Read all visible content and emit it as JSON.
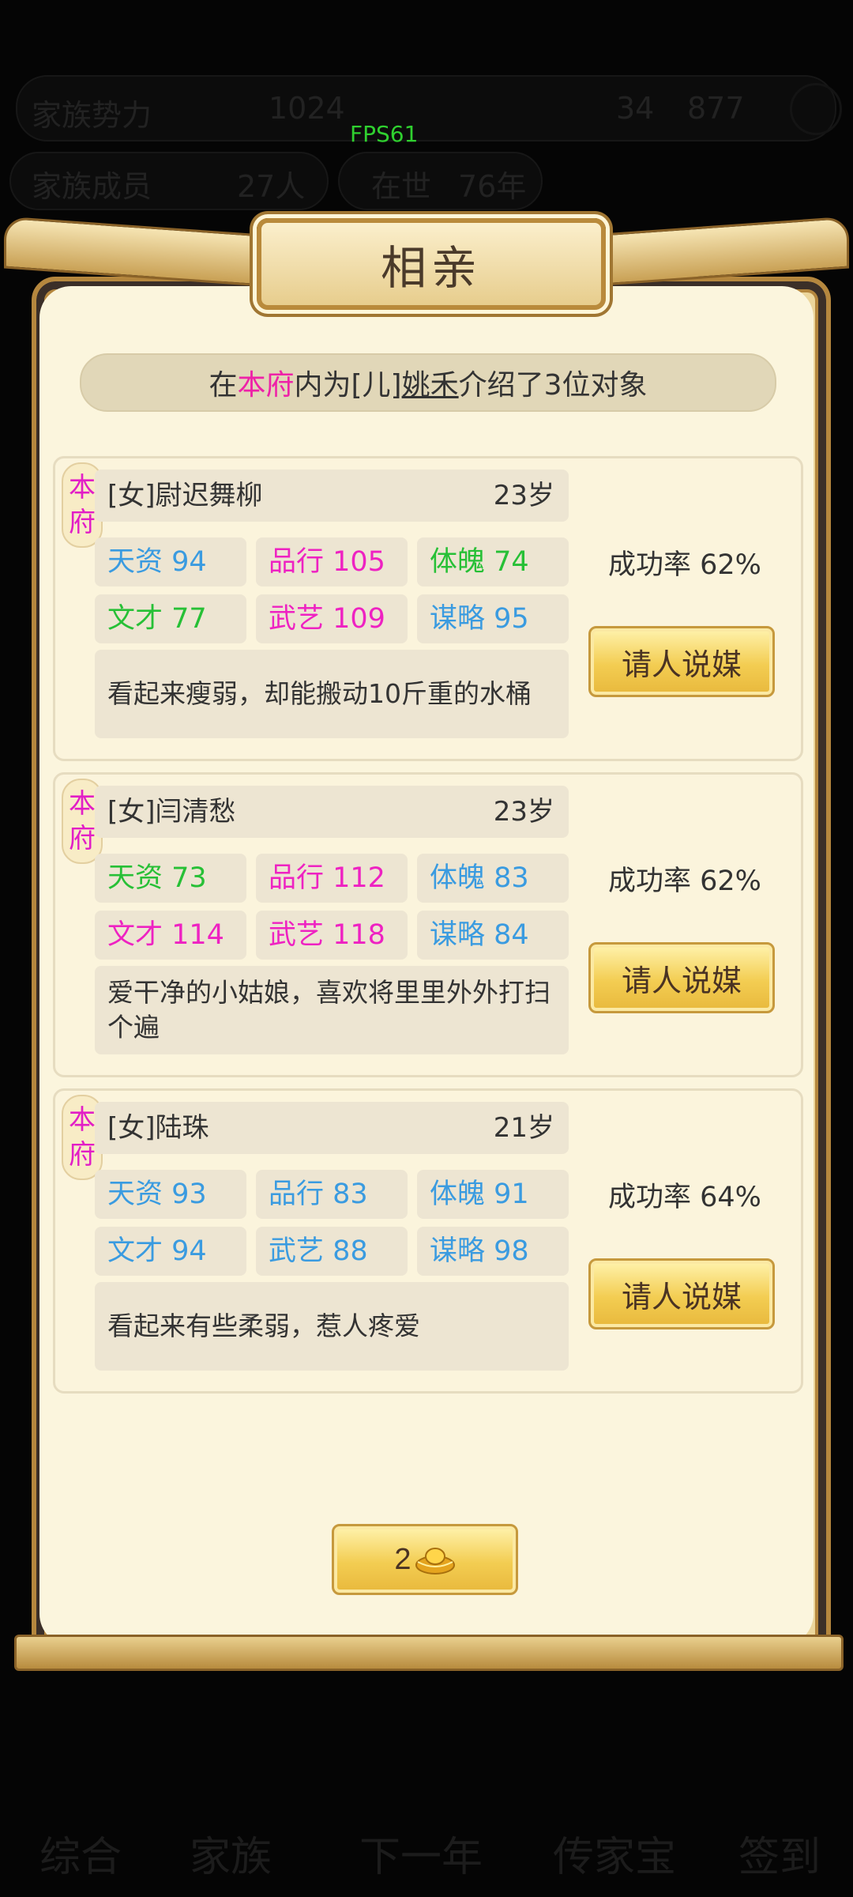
{
  "fps": "FPS61",
  "background_hud": {
    "row1": [
      "家族势力",
      "1024",
      "34",
      "877"
    ],
    "row2": [
      "家族成员",
      "27人",
      "在世",
      "76年"
    ],
    "nav": [
      "综合",
      "家族",
      "下一年",
      "传家宝",
      "签到"
    ]
  },
  "dialog": {
    "title": "相亲",
    "info": {
      "p1": "在",
      "p2": "本府",
      "p3": "内为[儿]",
      "p4": "姚禾",
      "p5": "介绍了3位对象"
    },
    "candidates": [
      {
        "badge": [
          "本",
          "府"
        ],
        "name": "[女]尉迟舞柳",
        "age": "23岁",
        "stats": [
          {
            "label": "天资 94",
            "color": "blue"
          },
          {
            "label": "品行 105",
            "color": "pink"
          },
          {
            "label": "体魄 74",
            "color": "green"
          },
          {
            "label": "文才 77",
            "color": "green"
          },
          {
            "label": "武艺 109",
            "color": "pink"
          },
          {
            "label": "谋略 95",
            "color": "blue"
          }
        ],
        "desc": "看起来瘦弱，却能搬动10斤重的水桶",
        "rate": "成功率 62%",
        "button": "请人说媒"
      },
      {
        "badge": [
          "本",
          "府"
        ],
        "name": "[女]闫清愁",
        "age": "23岁",
        "stats": [
          {
            "label": "天资 73",
            "color": "green"
          },
          {
            "label": "品行 112",
            "color": "pink"
          },
          {
            "label": "体魄 83",
            "color": "blue"
          },
          {
            "label": "文才 114",
            "color": "pink"
          },
          {
            "label": "武艺 118",
            "color": "pink"
          },
          {
            "label": "谋略 84",
            "color": "blue"
          }
        ],
        "desc": "爱干净的小姑娘，喜欢将里里外外打扫个遍",
        "rate": "成功率 62%",
        "button": "请人说媒"
      },
      {
        "badge": [
          "本",
          "府"
        ],
        "name": "[女]陆珠",
        "age": "21岁",
        "stats": [
          {
            "label": "天资 93",
            "color": "blue"
          },
          {
            "label": "品行 83",
            "color": "blue"
          },
          {
            "label": "体魄 91",
            "color": "blue"
          },
          {
            "label": "文才 94",
            "color": "blue"
          },
          {
            "label": "武艺 88",
            "color": "blue"
          },
          {
            "label": "谋略 98",
            "color": "blue"
          }
        ],
        "desc": "看起来有些柔弱，惹人疼爱",
        "rate": "成功率 64%",
        "button": "请人说媒"
      }
    ],
    "refresh": {
      "cost": "2",
      "icon": "gold-ingot-icon"
    }
  },
  "colors": {
    "green": "#27c036",
    "pink": "#ee22c2",
    "blue": "#3a9be0"
  }
}
